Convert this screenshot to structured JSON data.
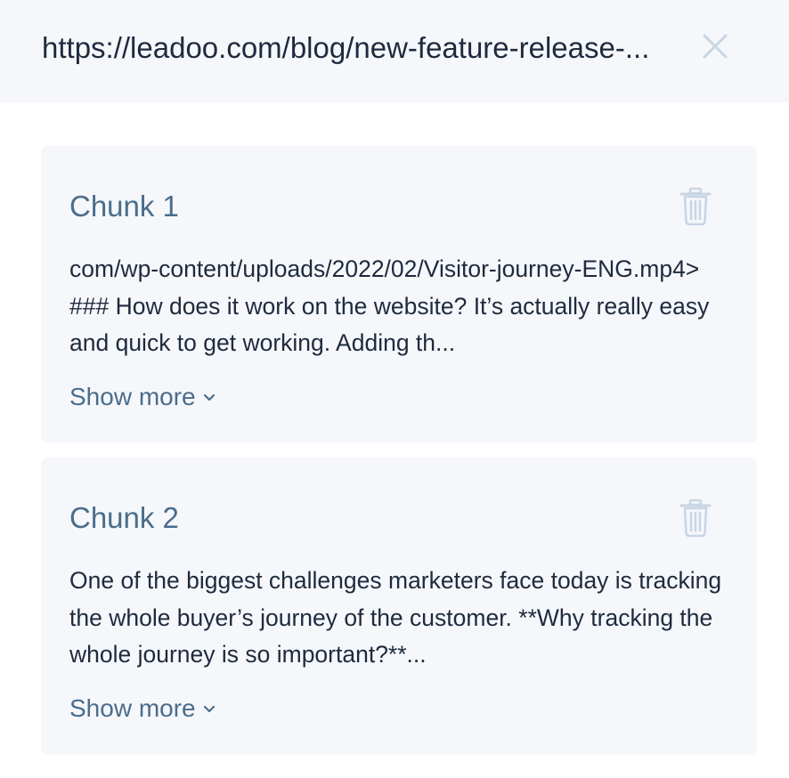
{
  "header": {
    "title": "https://leadoo.com/blog/new-feature-release-...",
    "close_icon": "close-icon"
  },
  "chunks": [
    {
      "title": "Chunk 1",
      "text": "com/wp-content/uploads/2022/02/Visitor-journey-ENG.mp4> ### How does it work on the website? It’s actually really easy and quick to get working. Adding th...",
      "show_more_label": "Show more",
      "delete_icon": "trash-icon"
    },
    {
      "title": "Chunk 2",
      "text": "One of the biggest challenges marketers face today is tracking the whole buyer’s journey of the customer. **Why tracking the whole journey is so important?**...",
      "show_more_label": "Show more",
      "delete_icon": "trash-icon"
    }
  ],
  "colors": {
    "header_bg": "#f5f7fb",
    "card_bg": "#f5f7fb",
    "text": "#1f2a3d",
    "accent": "#4a6d8c",
    "icon_muted": "#c9d5e3"
  }
}
